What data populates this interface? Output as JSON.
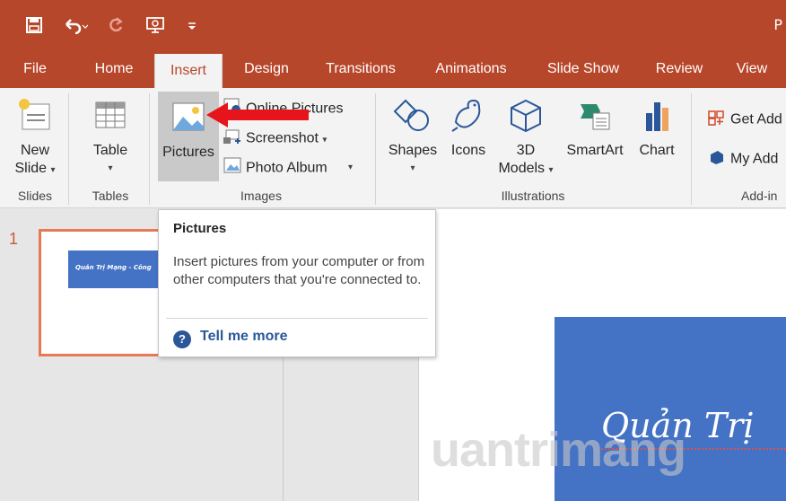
{
  "titlebar": {
    "app_letter": "P"
  },
  "tabs": [
    {
      "label": "File"
    },
    {
      "label": "Home"
    },
    {
      "label": "Insert"
    },
    {
      "label": "Design"
    },
    {
      "label": "Transitions"
    },
    {
      "label": "Animations"
    },
    {
      "label": "Slide Show"
    },
    {
      "label": "Review"
    },
    {
      "label": "View"
    }
  ],
  "ribbon": {
    "new_slide": {
      "line1": "New",
      "line2": "Slide"
    },
    "table": {
      "label": "Table"
    },
    "pictures": {
      "label": "Pictures"
    },
    "online_pictures": {
      "label": "Online Pictures"
    },
    "screenshot": {
      "label": "Screenshot"
    },
    "photo_album": {
      "label": "Photo Album"
    },
    "shapes": {
      "label": "Shapes"
    },
    "icons": {
      "label": "Icons"
    },
    "models_3d": {
      "line1": "3D",
      "line2": "Models"
    },
    "smartart": {
      "label": "SmartArt"
    },
    "chart": {
      "label": "Chart"
    },
    "get_addins": {
      "label": "Get Add"
    },
    "my_addins": {
      "label": "My Add"
    },
    "groups": {
      "slides": "Slides",
      "tables": "Tables",
      "images": "Images",
      "illustrations": "Illustrations",
      "addins": "Add-in"
    }
  },
  "slides_pane": {
    "slide_number": "1",
    "thumb_title": "Quản Trị Mạng - Công"
  },
  "tooltip": {
    "title": "Pictures",
    "description": "Insert pictures from your computer or from other computers that you're connected to.",
    "help_label": "Tell me more"
  },
  "main_slide": {
    "title": "Quản Trị"
  },
  "watermark": "uantrimang",
  "colors": {
    "title_bar": "#b7472a",
    "ribbon_bg": "#f3f3f3",
    "slide_blue": "#4472c4",
    "thumb_border": "#e97951",
    "arrow_red": "#e8141b",
    "help_blue": "#2b579a"
  }
}
